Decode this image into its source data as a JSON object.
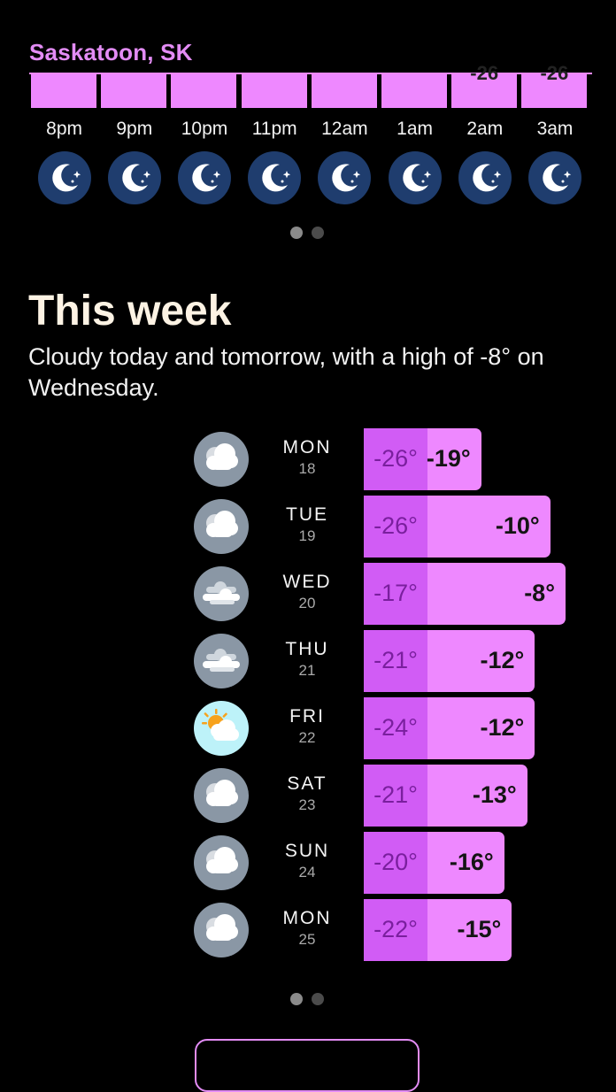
{
  "location": "Saskatoon, SK",
  "colors": {
    "accent": "#e38cf5",
    "bar": "#ee88ff",
    "bar_low": "#d15cf5",
    "moon_bg": "#1f3d6e",
    "cloud_icon_bg": "#8a97a5",
    "sunny_icon_bg": "#bdf2f9"
  },
  "hourly": [
    {
      "time": "8pm",
      "value": "",
      "icon": "moon-stars-icon"
    },
    {
      "time": "9pm",
      "value": "",
      "icon": "moon-stars-icon"
    },
    {
      "time": "10pm",
      "value": "",
      "icon": "moon-stars-icon"
    },
    {
      "time": "11pm",
      "value": "",
      "icon": "moon-stars-icon"
    },
    {
      "time": "12am",
      "value": "",
      "icon": "moon-stars-icon"
    },
    {
      "time": "1am",
      "value": "",
      "icon": "moon-stars-icon"
    },
    {
      "time": "2am",
      "value": "-26",
      "icon": "moon-stars-icon"
    },
    {
      "time": "3am",
      "value": "-26",
      "icon": "moon-stars-icon"
    }
  ],
  "hourly_pager": {
    "pages": 2,
    "current": 1
  },
  "week": {
    "title": "This week",
    "summary": "Cloudy today and tomorrow, with a high of -8° on Wednesday.",
    "days": [
      {
        "day": "MON",
        "date": "18",
        "low": "-26°",
        "high": "-19°",
        "low_value": -26,
        "high_value": -19,
        "icon": "cloudy-icon"
      },
      {
        "day": "TUE",
        "date": "19",
        "low": "-26°",
        "high": "-10°",
        "low_value": -26,
        "high_value": -10,
        "icon": "cloudy-icon"
      },
      {
        "day": "WED",
        "date": "20",
        "low": "-17°",
        "high": "-8°",
        "low_value": -17,
        "high_value": -8,
        "icon": "overcast-icon"
      },
      {
        "day": "THU",
        "date": "21",
        "low": "-21°",
        "high": "-12°",
        "low_value": -21,
        "high_value": -12,
        "icon": "overcast-icon"
      },
      {
        "day": "FRI",
        "date": "22",
        "low": "-24°",
        "high": "-12°",
        "low_value": -24,
        "high_value": -12,
        "icon": "partly-sunny-icon"
      },
      {
        "day": "SAT",
        "date": "23",
        "low": "-21°",
        "high": "-13°",
        "low_value": -21,
        "high_value": -13,
        "icon": "cloudy-icon"
      },
      {
        "day": "SUN",
        "date": "24",
        "low": "-20°",
        "high": "-16°",
        "low_value": -20,
        "high_value": -16,
        "icon": "cloudy-icon"
      },
      {
        "day": "MON",
        "date": "25",
        "low": "-22°",
        "high": "-15°",
        "low_value": -22,
        "high_value": -15,
        "icon": "cloudy-icon"
      }
    ]
  },
  "week_pager": {
    "pages": 2,
    "current": 1
  }
}
